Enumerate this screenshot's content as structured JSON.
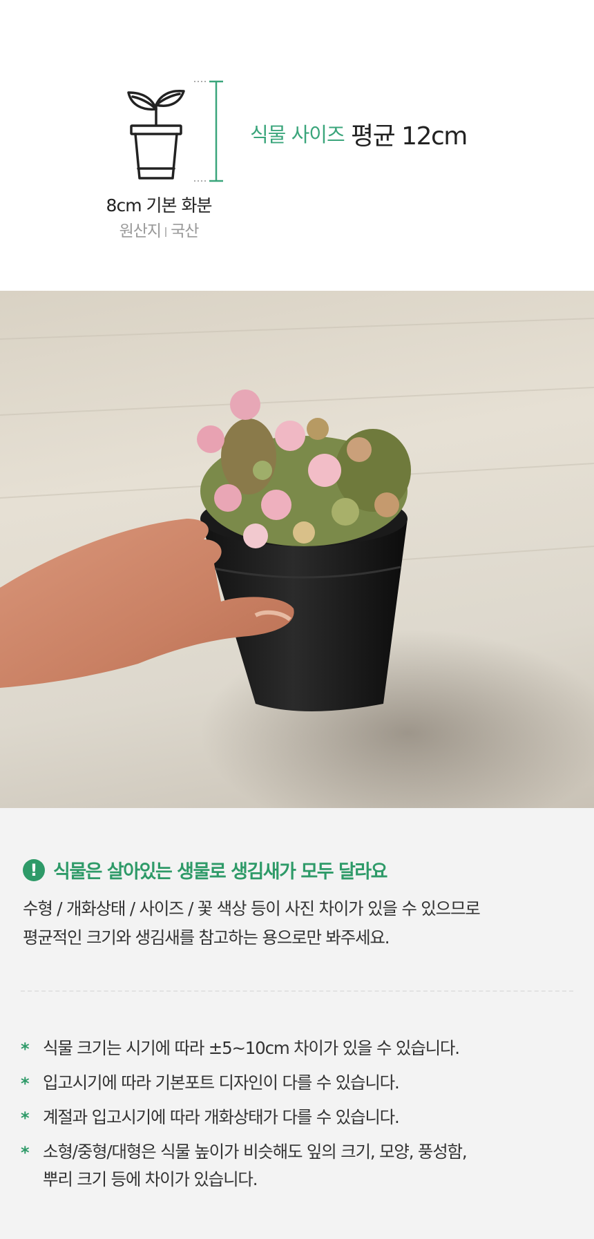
{
  "spec": {
    "size_label": "식물 사이즈",
    "size_value": "평균 12cm",
    "pot_name": "8cm 기본 화분",
    "origin_label": "원산지",
    "origin_value": "국산",
    "icons": {
      "pot": "potted-sprout-icon",
      "measure": "height-measure-icon"
    },
    "accent_color": "#3aa57b"
  },
  "photo": {
    "subject": "pink succulent in black plastic pot held by a hand"
  },
  "notice": {
    "title": "식물은 살아있는 생물로 생김새가 모두 달라요",
    "alert_icon_glyph": "!",
    "desc_line1": "수형 / 개화상태 / 사이즈 / 꽃 색상 등이 사진 차이가 있을 수 있으므로",
    "desc_line2": "평균적인 크기와 생김새를 참고하는 용으로만 봐주세요.",
    "bullet_glyph": "*",
    "bullets": [
      "식물 크기는 시기에 따라 ±5~10cm 차이가 있을 수 있습니다.",
      "입고시기에 따라 기본포트 디자인이 다를 수 있습니다.",
      "계절과 입고시기에 따라 개화상태가 다를 수 있습니다.",
      "소형/중형/대형은 식물 높이가 비슷해도 잎의 크기, 모양,  풍성함,\n뿌리 크기 등에 차이가 있습니다."
    ],
    "accent_color": "#2e9a68",
    "background": "#f3f3f3"
  }
}
